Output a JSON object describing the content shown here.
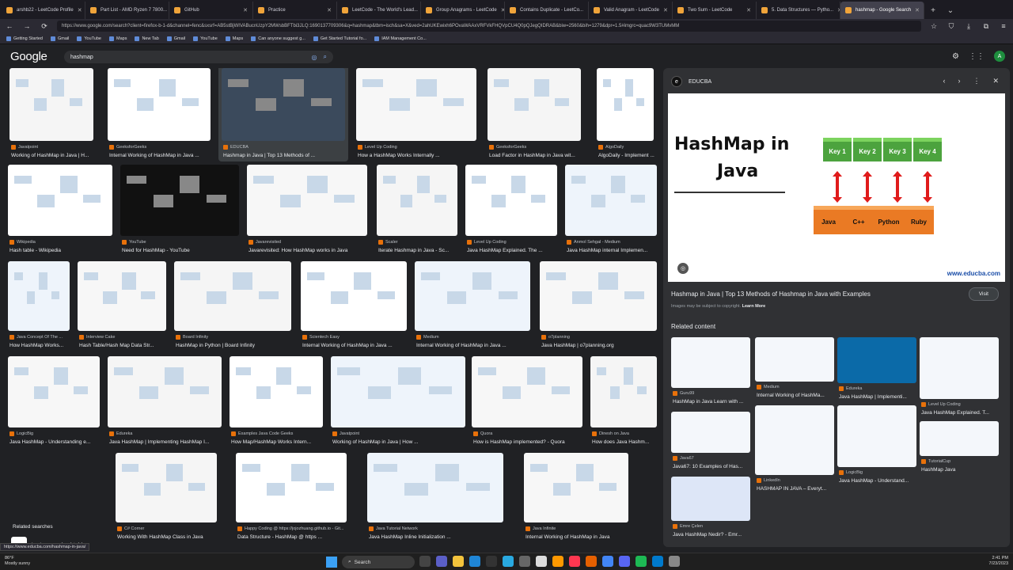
{
  "browser": {
    "tabs": [
      {
        "label": "arshb22 - LeetCode Profile",
        "active": false
      },
      {
        "label": "Part List - AMD Ryzen 7 7800...",
        "active": false
      },
      {
        "label": "GitHub",
        "active": false
      },
      {
        "label": "Practice",
        "active": false
      },
      {
        "label": "LeetCode - The World's Lead...",
        "active": false
      },
      {
        "label": "Group Anagrams - LeetCode",
        "active": false
      },
      {
        "label": "Contains Duplicate - LeetCo...",
        "active": false
      },
      {
        "label": "Valid Anagram - LeetCode",
        "active": false
      },
      {
        "label": "Two Sum - LeetCode",
        "active": false
      },
      {
        "label": "5. Data Structures — Pytho...",
        "active": false
      },
      {
        "label": "hashmap - Google Search",
        "active": true
      }
    ],
    "url": "https://www.google.com/search?client=firefox-b-1-d&channel=fenc&sxsrf=AB5stBjWIVABucnUzpY2MWsbBFTbi3JLQ:1690137709306&q=hashmap&tbm=isch&sa=X&ved=2ahUKEwixh6POvaWAAxVRFVkFHQVpCU4Q0pQJegQIDRAB&biw=2560&bih=1279&dpr=1.5#imgrc=quac9W3TUMvMM",
    "bookmarks": [
      "Getting Started",
      "Gmail",
      "YouTube",
      "Maps",
      "New Tab",
      "Gmail",
      "YouTube",
      "Maps",
      "Can anyone suggest g...",
      "Get Started Tutorial fo...",
      "IAM Management Co..."
    ]
  },
  "google": {
    "logo": "Google",
    "query": "hashmap",
    "avatar_letter": "A"
  },
  "results": [
    {
      "source": "Javatpoint",
      "title": "Working of HashMap in Java | H..."
    },
    {
      "source": "GeeksforGeeks",
      "title": "Internal Working of HashMap in Java ..."
    },
    {
      "source": "EDUCBA",
      "title": "Hashmap in Java | Top 13 Methods of ..."
    },
    {
      "source": "Level Up Coding",
      "title": "How a HashMap Works Internally ..."
    },
    {
      "source": "GeeksforGeeks",
      "title": "Load Factor in HashMap in Java wit..."
    },
    {
      "source": "AlgoDaily",
      "title": "AlgoDaily - Implement ..."
    },
    {
      "source": "Wikipedia",
      "title": "Hash table - Wikipedia"
    },
    {
      "source": "YouTube",
      "title": "Need for HashMap - YouTube"
    },
    {
      "source": "Javarevisited",
      "title": "Javarevisited: How HashMap works in Java"
    },
    {
      "source": "Scaler",
      "title": "Iterate Hashmap in Java - Sc..."
    },
    {
      "source": "Level Up Coding",
      "title": "Java HashMap Explained. The ..."
    },
    {
      "source": "Anmol Sehgal - Medium",
      "title": "Java HashMap internal Implemen..."
    },
    {
      "source": "Java Concept Of The ...",
      "title": "How HashMap Works..."
    },
    {
      "source": "Interview Cake",
      "title": "Hash Table/Hash Map Data Str..."
    },
    {
      "source": "Board Infinity",
      "title": "HashMap in Python | Board Infinity"
    },
    {
      "source": "Scientech Easy",
      "title": "Internal Working of HashMap in Java ..."
    },
    {
      "source": "Medium",
      "title": "Internal Working of HashMap in Java ..."
    },
    {
      "source": "o7planning",
      "title": "Java HashMap | o7planning.org"
    },
    {
      "source": "LogicBig",
      "title": "Java HashMap - Understanding e..."
    },
    {
      "source": "Edureka",
      "title": "Java HashMap | Implementing HashMap I..."
    },
    {
      "source": "Examples Java Code Geeks",
      "title": "How Map/HashMap Works Intern..."
    },
    {
      "source": "Javatpoint",
      "title": "Working of HashMap in Java | How ..."
    },
    {
      "source": "Quora",
      "title": "How is HashMap implemented? - Quora"
    },
    {
      "source": "Dinesh on Java",
      "title": "How does Java Hashm..."
    },
    {
      "source": "C# Corner",
      "title": "Working With HashMap Class in Java"
    },
    {
      "source": "Happy Coding @ https://jojozhuang.github.io - Git...",
      "title": "Data Structure - HashMap @ https ..."
    },
    {
      "source": "Java Tutorial Network",
      "title": "Java HashMap Inline Initialization ..."
    },
    {
      "source": "Java Infinite",
      "title": "Internal Working of HashMap in Java"
    }
  ],
  "related_searches": {
    "heading": "Related searches",
    "items": [
      {
        "prefix": "hashmap ",
        "bold": "vs hashtable"
      },
      {
        "prefix": "hashmap ",
        "bold": "python"
      },
      {
        "prefix": "hashmap ",
        "bold": "diagram"
      }
    ]
  },
  "preview": {
    "source": "EDUCBA",
    "image_title_line1": "HashMap in",
    "image_title_line2": "Java",
    "keys": [
      "Key 1",
      "Key 2",
      "Key 3",
      "Key 4"
    ],
    "values": [
      "Java",
      "C++",
      "Python",
      "Ruby"
    ],
    "watermark": "www.educba.com",
    "size_badge": "853 × 474",
    "title": "Hashmap in Java | Top 13 Methods of Hashmap in Java with Examples",
    "visit_label": "Visit",
    "copyright": "Images may be subject to copyright.",
    "learn_more": "Learn More",
    "related_heading": "Related content",
    "related": [
      {
        "source": "Guru99",
        "title": "HashMap in Java Learn with ..."
      },
      {
        "source": "Medium",
        "title": "Internal Working of HashMa..."
      },
      {
        "source": "Edureka",
        "title": "Java HashMap | Implementi..."
      },
      {
        "source": "Level Up Coding",
        "title": "Java HashMap Explained. T..."
      },
      {
        "source": "Java67",
        "title": "Java67: 10 Examples of Has..."
      },
      {
        "source": "LinkedIn",
        "title": "HASHMAP IN JAVA – Everyt..."
      },
      {
        "source": "LogicBig",
        "title": "Java HashMap - Understand..."
      },
      {
        "source": "TutorialCup",
        "title": "HashMap Java"
      },
      {
        "source": "Emre Çelen",
        "title": "Java HashMap Nedir? - Emr..."
      }
    ]
  },
  "status_url": "https://www.educba.com/hashmap-in-java/",
  "taskbar": {
    "temp": "86°F",
    "weather": "Mostly sunny",
    "search": "Search",
    "time": "2:41 PM",
    "date": "7/23/2023"
  },
  "colors": {
    "background": "#202124",
    "panel": "#303134",
    "accent": "#8ab4f8"
  }
}
